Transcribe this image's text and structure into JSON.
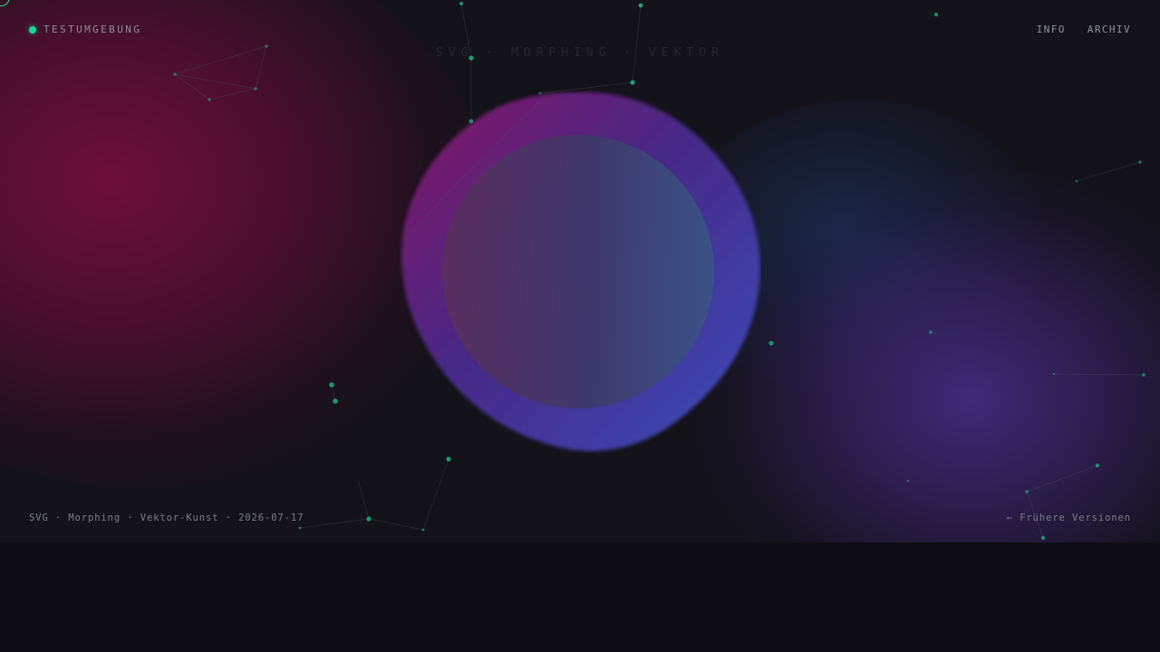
{
  "header": {
    "brand": "TESTUMGEBUNG",
    "nav": [
      {
        "label": "INFO"
      },
      {
        "label": "ARCHIV"
      }
    ]
  },
  "hero": {
    "ghost_text": "SVG · MORPHING · VEKTOR"
  },
  "footer": {
    "meta": "SVG · Morphing · Vektor-Kunst · 2026-07-17",
    "previous_link": "← Frühere Versionen"
  },
  "colors": {
    "accent": "#19d991",
    "blob_start": "#8a1768",
    "blob_end": "#3f4fc4",
    "text_muted": "#8d8f9a"
  },
  "icons": {
    "brand": "status-dot-icon",
    "cursor": "cursor-ring-icon"
  }
}
